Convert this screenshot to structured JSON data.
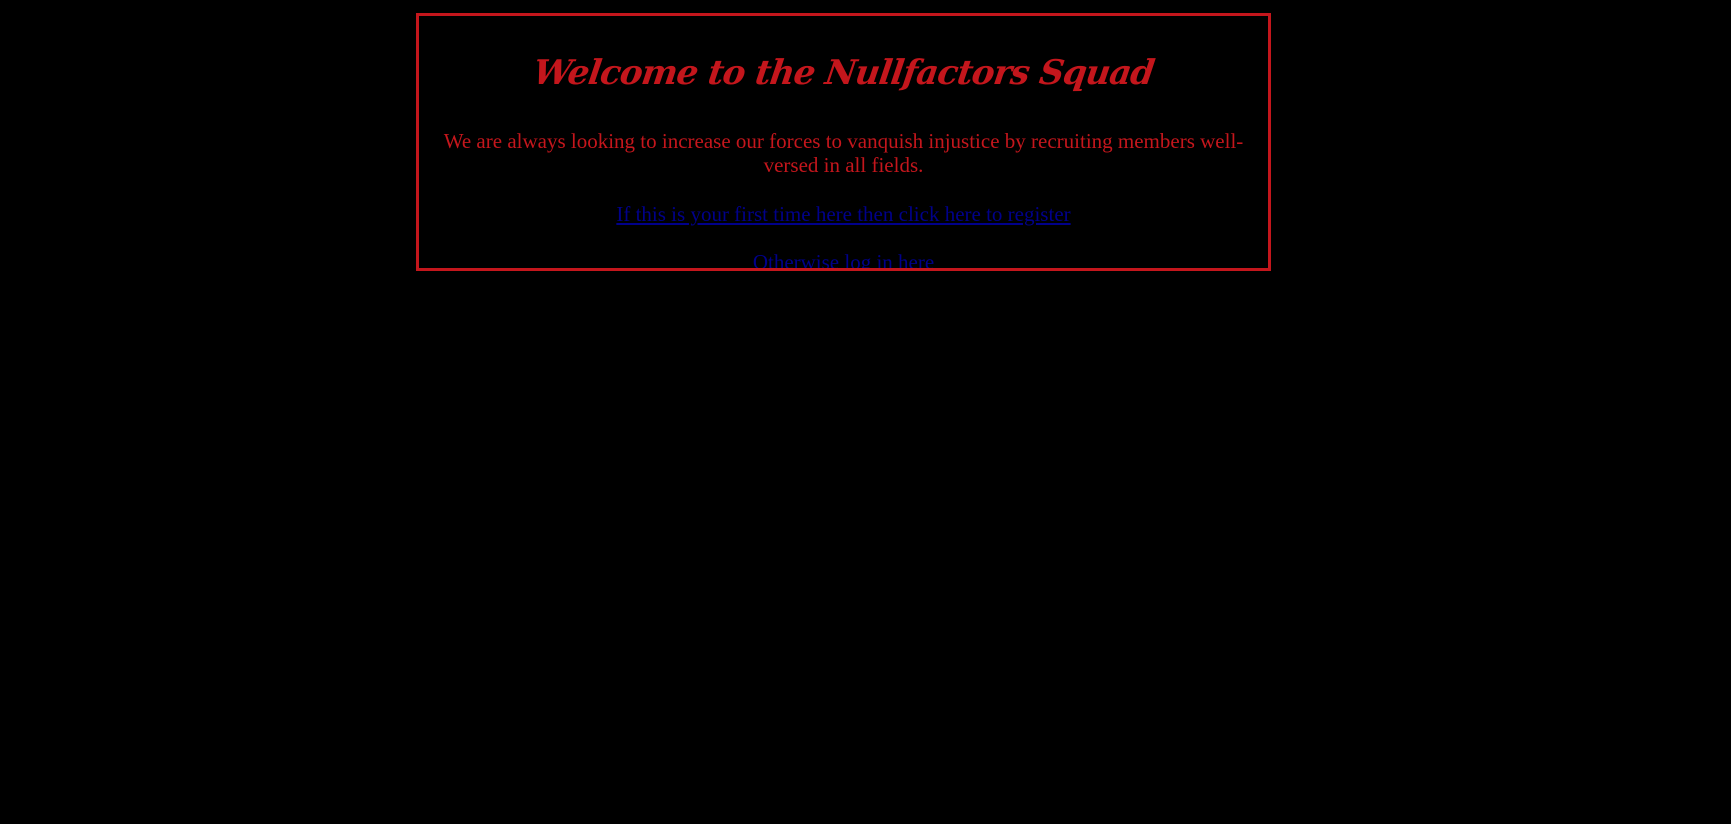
{
  "panel": {
    "title": "Welcome to the Nullfactors Squad",
    "intro": "We are always looking to increase our forces to vanquish injustice by recruiting members well-versed in all fields.",
    "register_link": "If this is your first time here then click here to register",
    "login_link": "Otherwise log in here"
  },
  "colors": {
    "background": "#000000",
    "accent_red": "#c4161c",
    "link_blue": "#00008b"
  }
}
